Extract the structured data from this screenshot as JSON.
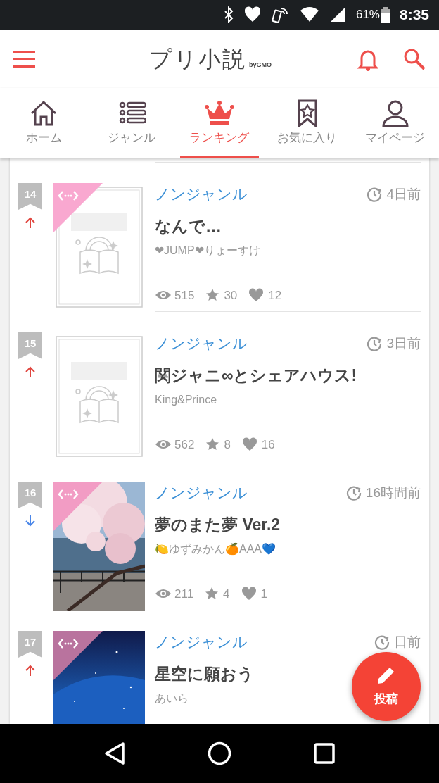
{
  "status_bar": {
    "battery": "61%",
    "time": "8:35"
  },
  "header": {
    "logo": "プリ小説",
    "logo_sub": "byGMO"
  },
  "tabs": [
    {
      "label": "ホーム",
      "selected": false
    },
    {
      "label": "ジャンル",
      "selected": false
    },
    {
      "label": "ランキング",
      "selected": true
    },
    {
      "label": "お気に入り",
      "selected": false
    },
    {
      "label": "マイページ",
      "selected": false
    }
  ],
  "items": [
    {
      "rank": "14",
      "kind": "up",
      "thumbnail": {
        "kind": "placeholder"
      },
      "color": "#f9a8d0",
      "genre": "ノンジャンル",
      "time": "4日前",
      "title": "なんで…",
      "author": "❤JUMP❤りょーすけ",
      "views": "515",
      "stars": "30",
      "likes": "12"
    },
    {
      "rank": "15",
      "kind": "up",
      "thumbnail": {
        "kind": "placeholder"
      },
      "genre": "ノンジャンル",
      "time": "3日前",
      "title": "関ジャニ∞とシェアハウス!",
      "author": "King&Prince",
      "views": "562",
      "stars": "8",
      "likes": "16"
    },
    {
      "rank": "16",
      "kind": "down",
      "color": "#f29cc4",
      "genre": "ノンジャンル",
      "time": "16時間前",
      "title": "夢のまた夢 Ver.2",
      "author": "🍋ゆずみかん🍊AAA💙",
      "views": "211",
      "stars": "4",
      "likes": "1"
    },
    {
      "rank": "17",
      "kind": "up",
      "color": "#b9739e",
      "genre": "ノンジャンル",
      "time": "日前",
      "title": "星空に願おう",
      "author": "あいら"
    }
  ],
  "fab": {
    "label": "投稿"
  }
}
